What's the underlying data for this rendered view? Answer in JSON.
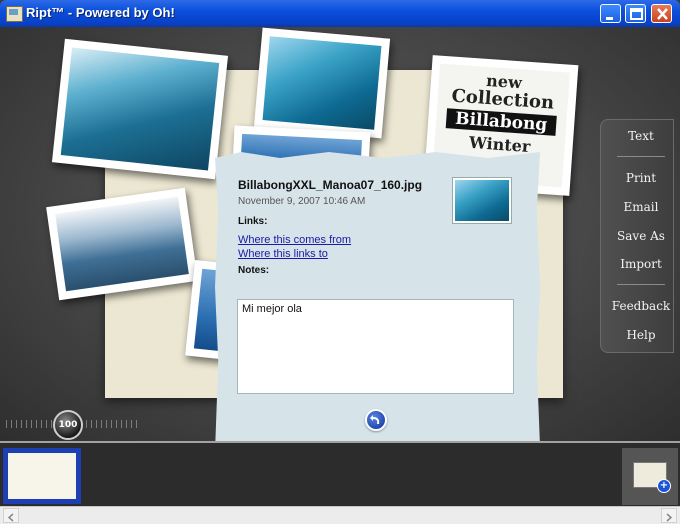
{
  "window": {
    "title": "Ript™ - Powered by Oh!",
    "controls": [
      "minimize-icon",
      "maximize-icon",
      "close-icon"
    ]
  },
  "stage": {
    "photos": [
      "surfer-wave-photo",
      "surfer-tube-photo",
      "barrel-wave-photo",
      "beach-photo",
      "billabong-ad-photo",
      "blue-photo"
    ],
    "billabong_text": [
      "new",
      "Collection",
      "Billabong",
      "Winter"
    ],
    "zoom": {
      "value": "100"
    }
  },
  "side_menu": {
    "items": [
      "Text",
      "Print",
      "Email",
      "Save As",
      "Import",
      "Feedback",
      "Help"
    ]
  },
  "info_card": {
    "filename": "BillabongXXL_Manoa07_160.jpg",
    "date": "November 9, 2007 10:46 AM",
    "links_label": "Links:",
    "link_from": "Where this comes from",
    "link_to": "Where this links to",
    "notes_label": "Notes:",
    "notes_value": "Mi mejor ola"
  },
  "colors": {
    "accent": "#0a4fdc",
    "card": "#d6e4ea",
    "mat": "#ece7d2",
    "link": "#1a1aa6"
  }
}
